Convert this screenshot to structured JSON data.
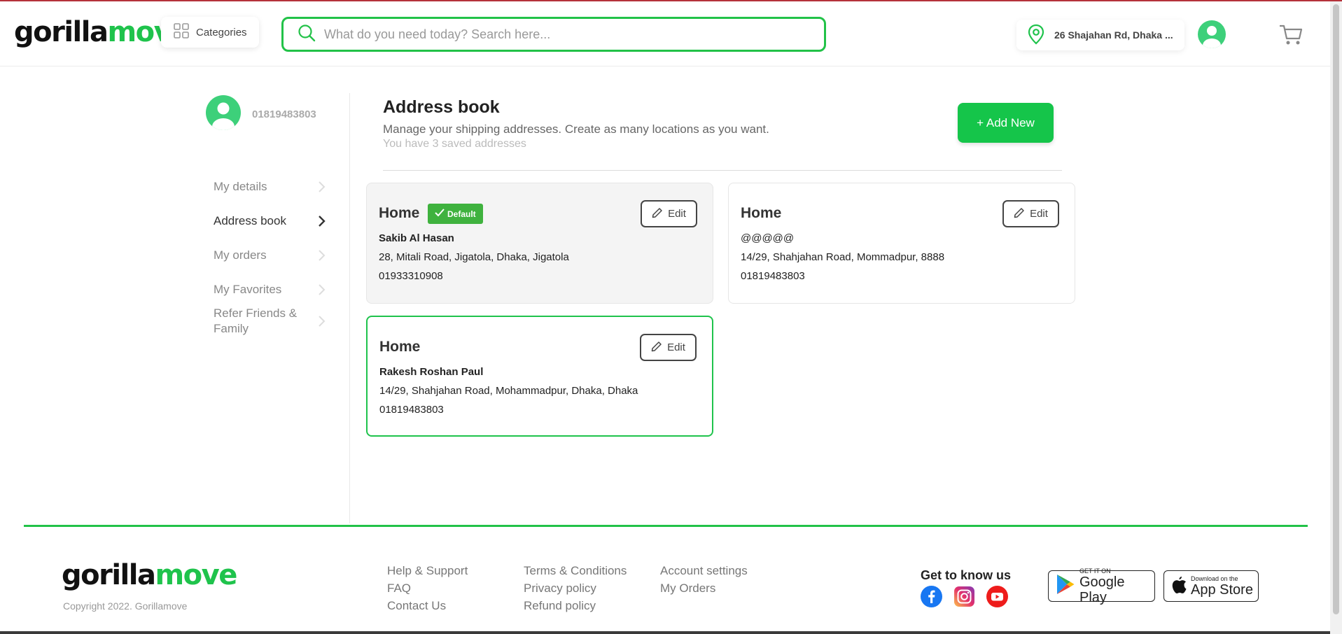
{
  "header": {
    "logo_part1": "gorilla",
    "logo_part2": "move",
    "categories_label": "Categories",
    "search_placeholder": "What do you need today? Search here...",
    "location": "26 Shajahan Rd, Dhaka ..."
  },
  "sidebar": {
    "phone": "01819483803",
    "items": [
      {
        "label": "My details"
      },
      {
        "label": "Address book"
      },
      {
        "label": "My orders"
      },
      {
        "label": "My Favorites"
      },
      {
        "label": "Refer Friends & Family"
      }
    ]
  },
  "main": {
    "title": "Address book",
    "subtitle": "Manage your shipping addresses. Create as many locations as you want.",
    "count_text": "You have 3 saved addresses",
    "add_new_label": "+ Add New",
    "edit_label": "Edit",
    "default_badge": "Default",
    "addresses": [
      {
        "title": "Home",
        "name": "Sakib Al Hasan",
        "address": "28, Mitali Road, Jigatola, Dhaka, Jigatola",
        "phone": "01933310908"
      },
      {
        "title": "Home",
        "name": "@@@@@",
        "address": "14/29, Shahjahan Road, Mommadpur, 8888",
        "phone": "01819483803"
      },
      {
        "title": "Home",
        "name": "Rakesh Roshan Paul",
        "address": "14/29, Shahjahan Road, Mohammadpur, Dhaka, Dhaka",
        "phone": "01819483803"
      }
    ]
  },
  "footer": {
    "logo_part1": "gorilla",
    "logo_part2": "move",
    "copyright": "Copyright 2022. Gorillamove",
    "col1": [
      "Help & Support",
      "FAQ",
      "Contact Us"
    ],
    "col2": [
      "Terms & Conditions",
      "Privacy policy",
      "Refund policy"
    ],
    "col3": [
      "Account settings",
      "My Orders"
    ],
    "social_heading": "Get to know us",
    "social_icons": [
      "facebook-icon",
      "instagram-icon",
      "youtube-icon"
    ],
    "google_play": {
      "small": "GET IT ON",
      "big": "Google Play"
    },
    "app_store": {
      "small": "Download on the",
      "big": "App Store"
    }
  },
  "colors": {
    "brand_green": "#1fc34c",
    "badge_green": "#3fb23e",
    "top_border": "#b5323a"
  }
}
